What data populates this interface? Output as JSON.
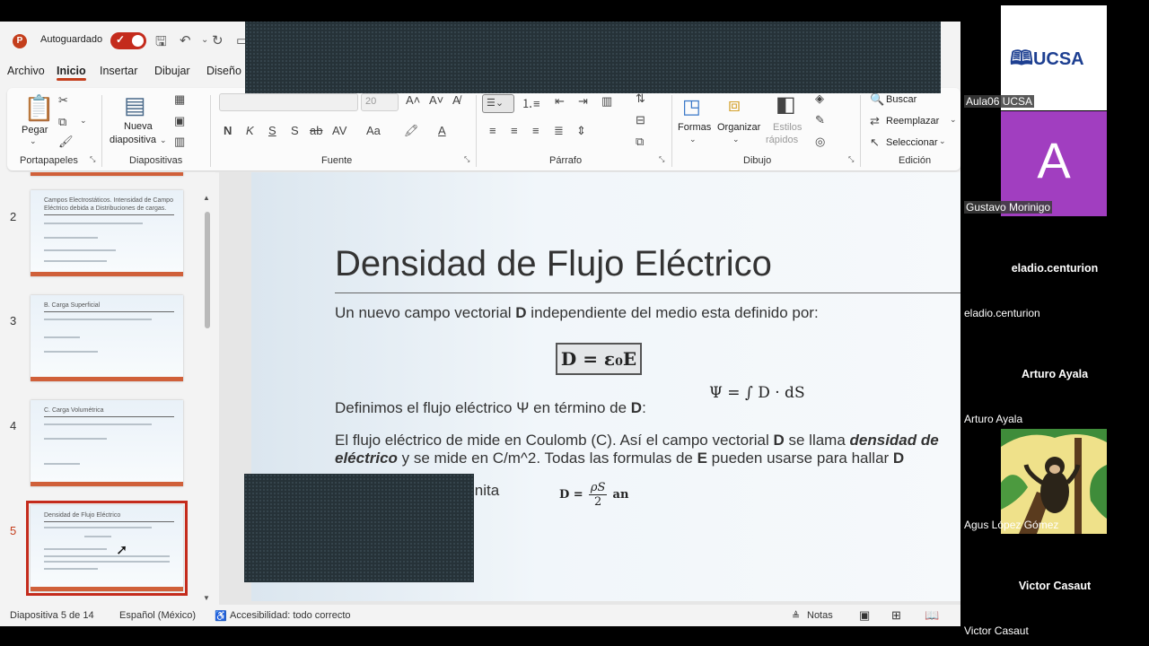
{
  "titlebar": {
    "autosave_label": "Autoguardado",
    "app_icon_letter": "P"
  },
  "tabs": [
    "Archivo",
    "Inicio",
    "Insertar",
    "Dibujar",
    "Diseño"
  ],
  "ribbon": {
    "paste_label": "Pegar",
    "new_slide_label": "Nueva",
    "new_slide_label2": "diapositiva",
    "font_name": "",
    "font_size": "20",
    "shapes_label": "Formas",
    "arrange_label": "Organizar",
    "quick_styles_label": "Estilos",
    "quick_styles_label2": "rápidos",
    "find_label": "Buscar",
    "replace_label": "Reemplazar",
    "select_label": "Seleccionar",
    "groups": [
      "Portapapeles",
      "Diapositivas",
      "Fuente",
      "Párrafo",
      "Dibujo",
      "Edición"
    ],
    "format_buttons": [
      "N",
      "K",
      "S",
      "S",
      "ab",
      "AV",
      "Aa"
    ]
  },
  "thumbnails": [
    {
      "number": "2",
      "title": "Campos Electrostáticos. Intensidad de Campo Eléctrico debida a Distribuciones de cargas."
    },
    {
      "number": "3",
      "title": "B. Carga Superficial"
    },
    {
      "number": "4",
      "title": "C. Carga Volumétrica"
    },
    {
      "number": "5",
      "title": "Densidad de Flujo Eléctrico",
      "active": true
    }
  ],
  "slide": {
    "title": "Densidad de Flujo Eléctrico",
    "line1_a": "Un nuevo campo vectorial ",
    "line1_b": "D",
    "line1_c": " independiente del medio esta definido por:",
    "eq_box": "D = ε₀E",
    "line2_a": "Definimos el flujo eléctrico Ψ en término de ",
    "line2_b": "D",
    "line2_c": ":",
    "eq_flux": "Ψ = ∫ D · dS",
    "line3_a": "El flujo eléctrico de mide en Coulomb (C). Así el campo vectorial ",
    "line3_b": "D",
    "line3_c": " se llama ",
    "line3_d": "densidad de",
    "line4_a": "eléctrico",
    "line4_b": " y se mide en C/m^2. Todas las formulas de ",
    "line4_c": "E",
    "line4_d": " pueden usarse para hallar ",
    "line4_e": "D",
    "line5": "inita",
    "eq_sheet_lhs": "D =",
    "eq_sheet_num": "ρS",
    "eq_sheet_den": "2",
    "eq_sheet_rhs": "an"
  },
  "statusbar": {
    "slide_info": "Diapositiva 5 de 14",
    "language": "Español (México)",
    "accessibility": "Accesibilidad: todo correcto",
    "notes": "Notas"
  },
  "participants": [
    {
      "name": "Aula06 UCSA",
      "logo_text": "UCSA"
    },
    {
      "name": "Gustavo Morinigo",
      "initial": "A",
      "color": "#a13ec0"
    },
    {
      "name": "eladio.centurion",
      "display": "eladio.centurion"
    },
    {
      "name": "Arturo Ayala",
      "display": "Arturo Ayala"
    },
    {
      "name": "Agus López Gómez"
    },
    {
      "name": "Victor Casaut",
      "display": "Victor Casaut"
    }
  ]
}
